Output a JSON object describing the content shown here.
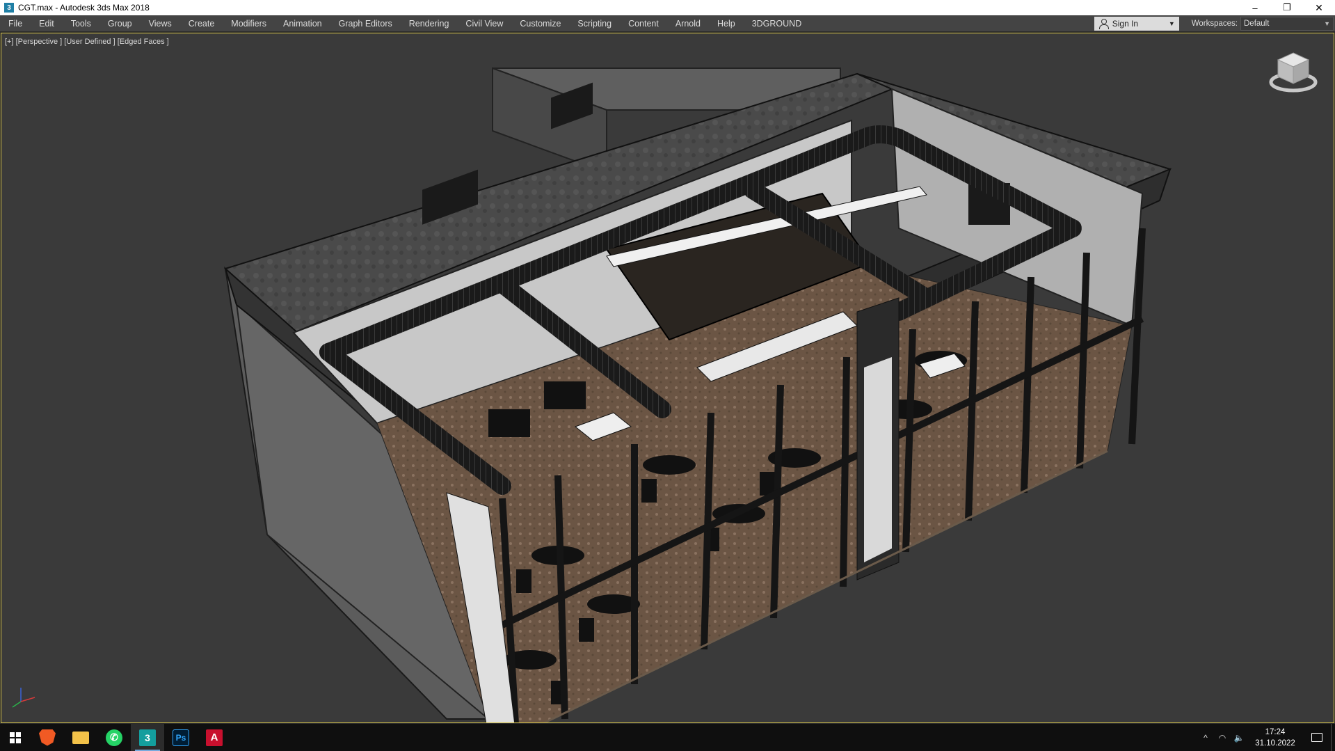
{
  "window": {
    "icon": "3",
    "title": "CGT.max - Autodesk 3ds Max 2018",
    "minimize": "–",
    "maximize": "❐",
    "close": "✕"
  },
  "menu": {
    "items": [
      "File",
      "Edit",
      "Tools",
      "Group",
      "Views",
      "Create",
      "Modifiers",
      "Animation",
      "Graph Editors",
      "Rendering",
      "Civil View",
      "Customize",
      "Scripting",
      "Content",
      "Arnold",
      "Help",
      "3DGROUND"
    ],
    "sign_in": "Sign In",
    "workspaces_label": "Workspaces:",
    "workspace_value": "Default"
  },
  "viewport": {
    "label": "[+] [Perspective ] [User Defined ] [Edged Faces ]",
    "border_color": "#d6c34a"
  },
  "taskbar": {
    "apps": [
      {
        "name": "brave-icon",
        "glyph": "",
        "active": false
      },
      {
        "name": "file-explorer-icon",
        "glyph": "",
        "active": false
      },
      {
        "name": "whatsapp-icon",
        "glyph": "✆",
        "active": false
      },
      {
        "name": "3ds-max-icon",
        "glyph": "3",
        "active": true
      },
      {
        "name": "photoshop-icon",
        "glyph": "Ps",
        "active": false
      },
      {
        "name": "autocad-icon",
        "glyph": "A",
        "active": false
      }
    ],
    "tray": {
      "chevron": "^",
      "network": "◠",
      "volume": "🔈"
    },
    "time": "17:24",
    "date": "31.10.2022"
  }
}
